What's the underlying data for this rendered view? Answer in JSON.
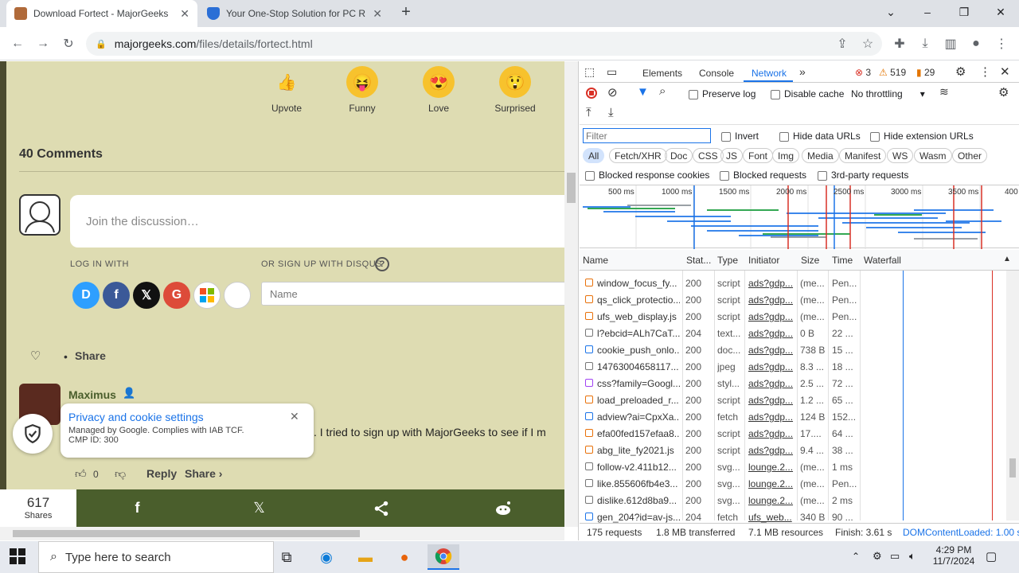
{
  "browser": {
    "tabs": [
      {
        "title": "Download Fortect - MajorGeeks"
      },
      {
        "title": "Your One-Stop Solution for PC R"
      }
    ],
    "new_tab": "+",
    "url_host": "majorgeeks.com",
    "url_path": "/files/details/fortect.html"
  },
  "page": {
    "reactions": [
      {
        "label": "Upvote",
        "emoji": "👍"
      },
      {
        "label": "Funny",
        "emoji": "😝"
      },
      {
        "label": "Love",
        "emoji": "😍"
      },
      {
        "label": "Surprised",
        "emoji": "😲"
      }
    ],
    "comments_title": "40 Comments",
    "discussion_placeholder": "Join the discussion…",
    "login_with": "LOG IN WITH",
    "or_signup": "OR SIGN UP WITH DISQUS",
    "name_placeholder": "Name",
    "share_label": "Share",
    "comment": {
      "author": "Maximus",
      "text": ". I tried to sign up with MajorGeeks to see if I m",
      "votes": "0",
      "reply": "Reply",
      "share": "Share ›"
    },
    "privacy": {
      "title": "Privacy and cookie settings",
      "line1": "Managed by Google. Complies with IAB TCF.",
      "line2": "CMP ID: 300"
    },
    "shares_count": "617",
    "shares_label": "Shares"
  },
  "devtools": {
    "tabs": [
      "Elements",
      "Console",
      "Network"
    ],
    "errors": "3",
    "warnings": "519",
    "issues": "29",
    "preserve_log": "Preserve log",
    "disable_cache": "Disable cache",
    "throttling": "No throttling",
    "filter_placeholder": "Filter",
    "invert": "Invert",
    "hide_data_urls": "Hide data URLs",
    "hide_ext_urls": "Hide extension URLs",
    "filter_types": [
      "All",
      "Fetch/XHR",
      "Doc",
      "CSS",
      "JS",
      "Font",
      "Img",
      "Media",
      "Manifest",
      "WS",
      "Wasm",
      "Other"
    ],
    "blocked_cookies": "Blocked response cookies",
    "blocked_requests": "Blocked requests",
    "third_party": "3rd-party requests",
    "ticks": [
      "500 ms",
      "1000 ms",
      "1500 ms",
      "2000 ms",
      "2500 ms",
      "3000 ms",
      "3500 ms",
      "400"
    ],
    "columns": [
      "Name",
      "Stat...",
      "Type",
      "Initiator",
      "Size",
      "Time",
      "Waterfall"
    ],
    "requests": [
      {
        "name": "window_focus_fy...",
        "status": "200",
        "type": "script",
        "initiator": "ads?gdp...",
        "size": "(me...",
        "time": "Pen..."
      },
      {
        "name": "qs_click_protectio...",
        "status": "200",
        "type": "script",
        "initiator": "ads?gdp...",
        "size": "(me...",
        "time": "Pen..."
      },
      {
        "name": "ufs_web_display.js",
        "status": "200",
        "type": "script",
        "initiator": "ads?gdp...",
        "size": "(me...",
        "time": "Pen..."
      },
      {
        "name": "l?ebcid=ALh7CaT...",
        "status": "204",
        "type": "text...",
        "initiator": "ads?gdp...",
        "size": "0 B",
        "time": "22 ..."
      },
      {
        "name": "cookie_push_onlo...",
        "status": "200",
        "type": "doc...",
        "initiator": "ads?gdp...",
        "size": "738 B",
        "time": "15 ..."
      },
      {
        "name": "14763004658117...",
        "status": "200",
        "type": "jpeg",
        "initiator": "ads?gdp...",
        "size": "8.3 ...",
        "time": "18 ..."
      },
      {
        "name": "css?family=Googl...",
        "status": "200",
        "type": "styl...",
        "initiator": "ads?gdp...",
        "size": "2.5 ...",
        "time": "72 ..."
      },
      {
        "name": "load_preloaded_r...",
        "status": "200",
        "type": "script",
        "initiator": "ads?gdp...",
        "size": "1.2 ...",
        "time": "65 ..."
      },
      {
        "name": "adview?ai=CpxXa...",
        "status": "200",
        "type": "fetch",
        "initiator": "ads?gdp...",
        "size": "124 B",
        "time": "152..."
      },
      {
        "name": "efa00fed157efaa8...",
        "status": "200",
        "type": "script",
        "initiator": "ads?gdp...",
        "size": "17....",
        "time": "64 ..."
      },
      {
        "name": "abg_lite_fy2021.js",
        "status": "200",
        "type": "script",
        "initiator": "ads?gdp...",
        "size": "9.4 ...",
        "time": "38 ..."
      },
      {
        "name": "follow-v2.411b12...",
        "status": "200",
        "type": "svg...",
        "initiator": "lounge.2...",
        "size": "(me...",
        "time": "1 ms"
      },
      {
        "name": "like.855606fb4e3...",
        "status": "200",
        "type": "svg...",
        "initiator": "lounge.2...",
        "size": "(me...",
        "time": "Pen..."
      },
      {
        "name": "dislike.612d8ba9...",
        "status": "200",
        "type": "svg...",
        "initiator": "lounge.2...",
        "size": "(me...",
        "time": "2 ms"
      },
      {
        "name": "gen_204?id=av-js...",
        "status": "204",
        "type": "fetch",
        "initiator": "ufs_web...",
        "size": "340 B",
        "time": "90 ..."
      }
    ],
    "status_requests": "175 requests",
    "status_transferred": "1.8 MB transferred",
    "status_resources": "7.1 MB resources",
    "status_finish": "Finish: 3.61 s",
    "status_dcl": "DOMContentLoaded: 1.00 s"
  },
  "taskbar": {
    "search_placeholder": "Type here to search",
    "time": "4:29 PM",
    "date": "11/7/2024"
  },
  "colors": {
    "page_bg": "#dedcb2",
    "share_bar": "#4a5e2c",
    "devtools_accent": "#1a73e8"
  }
}
